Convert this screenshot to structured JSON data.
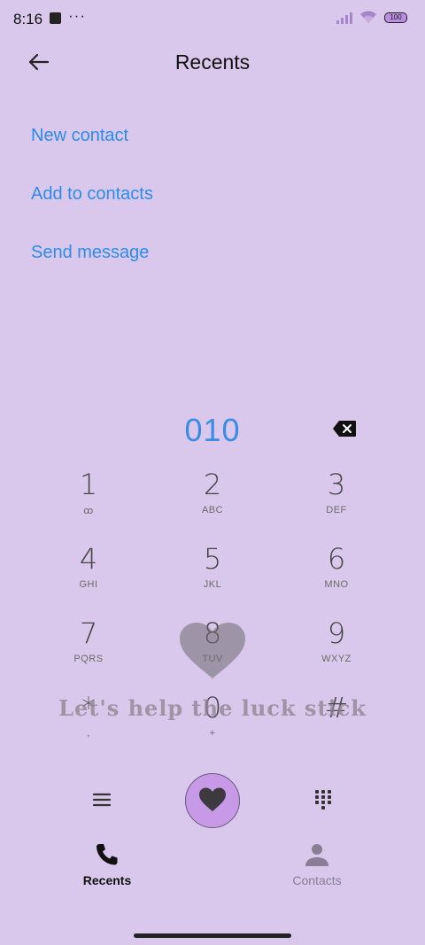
{
  "status": {
    "time": "8:16",
    "dots": "···",
    "battery": "100"
  },
  "header": {
    "title": "Recents"
  },
  "actions": {
    "new_contact": "New contact",
    "add_to_contacts": "Add to contacts",
    "send_message": "Send message"
  },
  "dialer": {
    "number": "010",
    "keys": [
      {
        "digit": "1",
        "letters": "ꝏ"
      },
      {
        "digit": "2",
        "letters": "ABC"
      },
      {
        "digit": "3",
        "letters": "DEF"
      },
      {
        "digit": "4",
        "letters": "GHI"
      },
      {
        "digit": "5",
        "letters": "JKL"
      },
      {
        "digit": "6",
        "letters": "MNO"
      },
      {
        "digit": "7",
        "letters": "PQRS"
      },
      {
        "digit": "8",
        "letters": "TUV"
      },
      {
        "digit": "9",
        "letters": "WXYZ"
      },
      {
        "digit": "*",
        "letters": ","
      },
      {
        "digit": "0",
        "letters": "+"
      },
      {
        "digit": "#",
        "letters": ""
      }
    ]
  },
  "overlay": {
    "text": "Let's help the luck stick"
  },
  "nav": {
    "recents": "Recents",
    "contacts": "Contacts"
  },
  "colors": {
    "background": "#d9c8ec",
    "link": "#2d8ce8",
    "call_button": "#c79ae8"
  }
}
